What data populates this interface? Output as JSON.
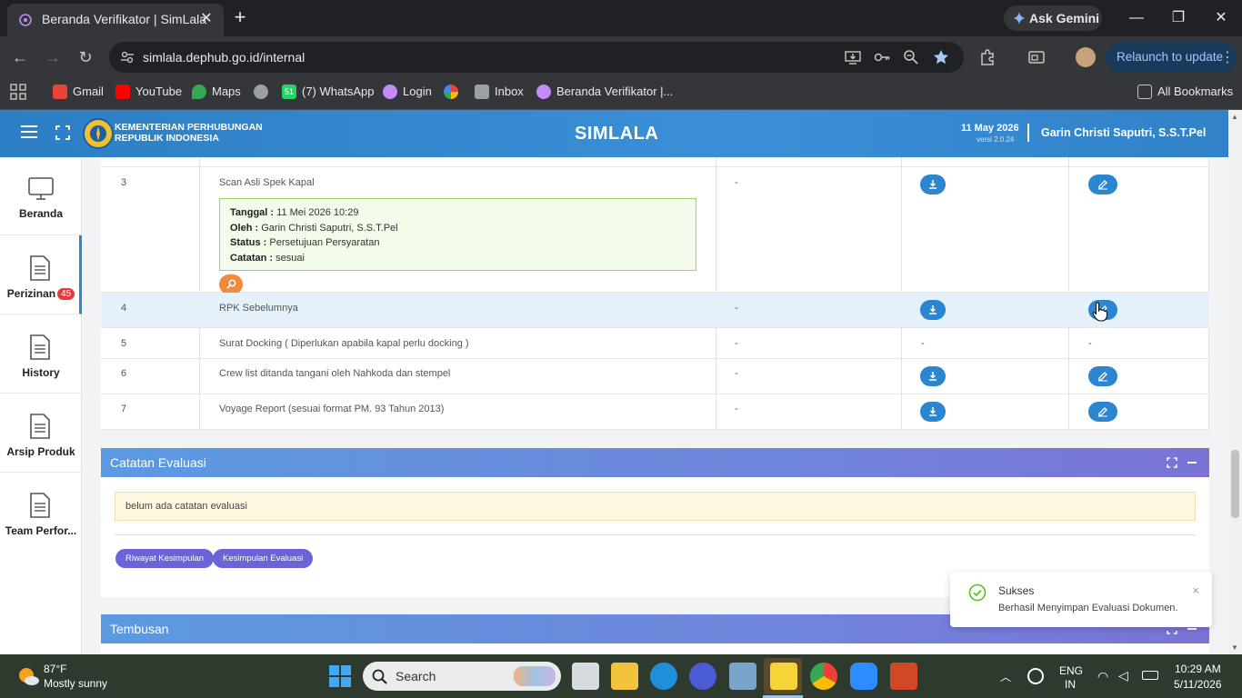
{
  "browser": {
    "tab_title": "Beranda Verifikator | SimLala",
    "new_tab": "+",
    "tab_close": "✕",
    "gemini_label": "Ask Gemini",
    "url": "simlala.dephub.go.id/internal",
    "relaunch_label": "Relaunch to update",
    "bookmarks": [
      {
        "label": "Gmail",
        "color": "#ea4335"
      },
      {
        "label": "YouTube",
        "color": "#ff0000"
      },
      {
        "label": "Maps",
        "color": "#34a853"
      },
      {
        "label": "",
        "color": "#9aa0a6"
      },
      {
        "label": "(7) WhatsApp",
        "color": "#25d366",
        "badge": "51"
      },
      {
        "label": "Login",
        "color": "#c58af9"
      },
      {
        "label": "",
        "color": "#fbbc04"
      },
      {
        "label": "Inbox",
        "color": "#9aa0a6"
      },
      {
        "label": "Beranda Verifikator |...",
        "color": "#c58af9"
      }
    ],
    "all_bookmarks": "All Bookmarks"
  },
  "app": {
    "org_line1": "KEMENTERIAN PERHUBUNGAN",
    "org_line2": "REPUBLIK INDONESIA",
    "title": "SIMLALA",
    "date": "11 May 2026",
    "version": "versi 2.0.24",
    "user": "Garin Christi Saputri, S.S.T.Pel"
  },
  "sidebar": {
    "items": [
      {
        "label": "Beranda"
      },
      {
        "label": "Perizinan",
        "badge": "45"
      },
      {
        "label": "History"
      },
      {
        "label": "Arsip Produk"
      },
      {
        "label": "Team Perfor..."
      }
    ]
  },
  "documents": {
    "rows": [
      {
        "no": "3",
        "name": "Scan Asli Spek Kapal",
        "col3": "-",
        "info": {
          "tanggal_label": "Tanggal :",
          "tanggal": "11 Mei 2026 10:29",
          "oleh_label": "Oleh :",
          "oleh": "Garin Christi Saputri, S.S.T.Pel",
          "status_label": "Status :",
          "status": "Persetujuan Persyaratan",
          "catatan_label": "Catatan :",
          "catatan": "sesuai"
        }
      },
      {
        "no": "4",
        "name": "RPK Sebelumnya",
        "col3": "-"
      },
      {
        "no": "5",
        "name": "Surat Docking ( Diperlukan apabila kapal perlu docking )",
        "col3": "-",
        "col4": "-",
        "col5": "-"
      },
      {
        "no": "6",
        "name": "Crew list ditanda tangani oleh Nahkoda dan stempel",
        "col3": "-"
      },
      {
        "no": "7",
        "name": "Voyage Report (sesuai format PM. 93 Tahun 2013)",
        "col3": "-"
      }
    ]
  },
  "evaluasi": {
    "title": "Catatan Evaluasi",
    "note": "belum ada catatan evaluasi",
    "btn_riwayat": "Riwayat Kesimpulan",
    "btn_kesimpulan": "Kesimpulan Evaluasi"
  },
  "tembusan": {
    "title": "Tembusan"
  },
  "toast": {
    "title": "Sukses",
    "message": "Berhasil Menyimpan Evaluasi Dokumen.",
    "close": "×"
  },
  "taskbar": {
    "temp": "87°F",
    "weather": "Mostly sunny",
    "search_placeholder": "Search",
    "lang1": "ENG",
    "lang2": "IN",
    "time": "10:29 AM",
    "date": "5/11/2026"
  },
  "colors": {
    "header_blue": "#3a8fd6",
    "action_blue": "#2b85cf",
    "pill_purple": "#6c63d9",
    "success_green": "#52c41a"
  }
}
